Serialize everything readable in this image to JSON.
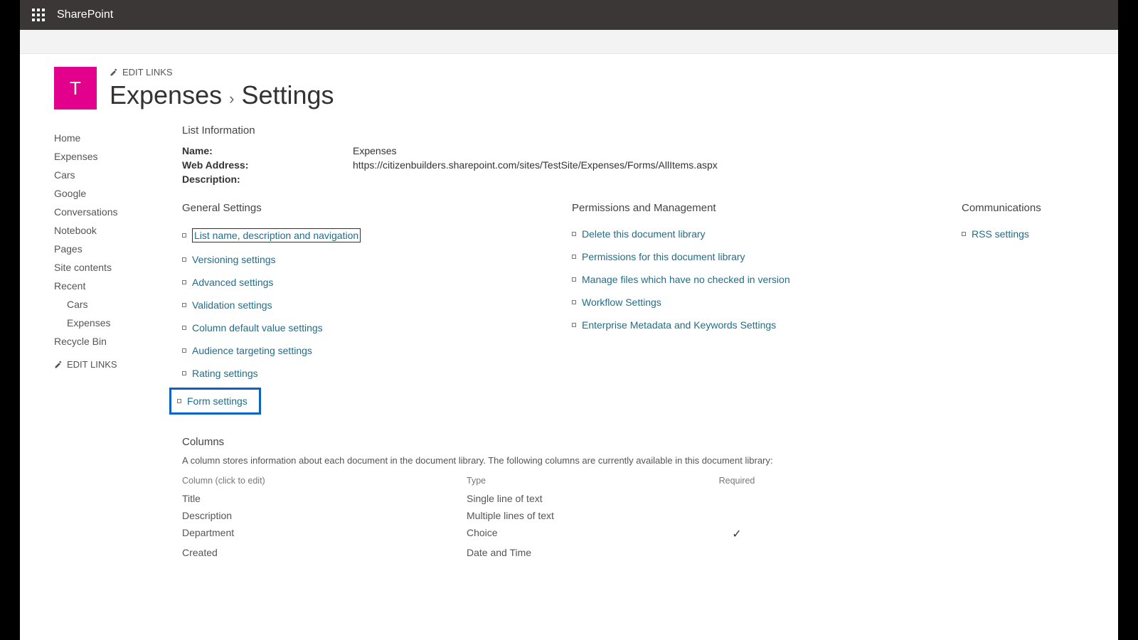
{
  "suite": {
    "brand": "SharePoint"
  },
  "site_icon_letter": "T",
  "edit_links_label": "EDIT LINKS",
  "title": {
    "main": "Expenses",
    "crumb": "Settings"
  },
  "left_nav": {
    "items": [
      "Home",
      "Expenses",
      "Cars",
      "Google",
      "Conversations",
      "Notebook",
      "Pages",
      "Site contents"
    ],
    "recent_label": "Recent",
    "recent_items": [
      "Cars",
      "Expenses"
    ],
    "recycle": "Recycle Bin"
  },
  "list_info": {
    "header": "List Information",
    "name_label": "Name:",
    "name_value": "Expenses",
    "addr_label": "Web Address:",
    "addr_value": "https://citizenbuilders.sharepoint.com/sites/TestSite/Expenses/Forms/AllItems.aspx",
    "desc_label": "Description:"
  },
  "settings_cols": {
    "general": {
      "title": "General Settings",
      "links": [
        "List name, description and navigation",
        "Versioning settings",
        "Advanced settings",
        "Validation settings",
        "Column default value settings",
        "Audience targeting settings",
        "Rating settings",
        "Form settings"
      ]
    },
    "perm": {
      "title": "Permissions and Management",
      "links": [
        "Delete this document library",
        "Permissions for this document library",
        "Manage files which have no checked in version",
        "Workflow Settings",
        "Enterprise Metadata and Keywords Settings"
      ]
    },
    "comm": {
      "title": "Communications",
      "links": [
        "RSS settings"
      ]
    }
  },
  "columns_section": {
    "title": "Columns",
    "desc": "A column stores information about each document in the document library. The following columns are currently available in this document library:",
    "head": {
      "c1": "Column (click to edit)",
      "c2": "Type",
      "c3": "Required"
    },
    "rows": [
      {
        "name": "Title",
        "type": "Single line of text",
        "required": false
      },
      {
        "name": "Description",
        "type": "Multiple lines of text",
        "required": false
      },
      {
        "name": "Department",
        "type": "Choice",
        "required": true
      },
      {
        "name": "Created",
        "type": "Date and Time",
        "required": false
      }
    ]
  }
}
